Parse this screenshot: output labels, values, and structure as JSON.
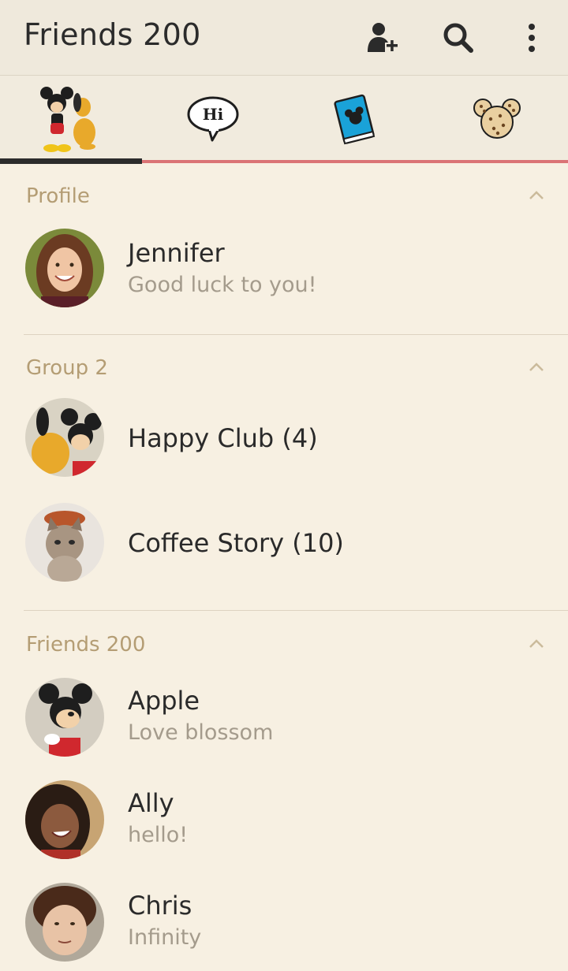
{
  "header": {
    "title": "Friends 200",
    "icons": [
      "add-friend-icon",
      "search-icon",
      "more-icon"
    ]
  },
  "tabs": [
    {
      "name": "friends",
      "icon": "mickey-pluto-icon"
    },
    {
      "name": "chats",
      "icon": "hi-speech-bubble-icon"
    },
    {
      "name": "timeline",
      "icon": "blue-book-icon"
    },
    {
      "name": "more",
      "icon": "cookie-icon"
    }
  ],
  "sections": {
    "profile": {
      "title": "Profile",
      "rows": [
        {
          "name": "Jennifer",
          "status": "Good luck to you!"
        }
      ]
    },
    "groups": {
      "title": "Group 2",
      "rows": [
        {
          "name": "Happy Club (4)"
        },
        {
          "name": "Coffee Story (10)"
        }
      ]
    },
    "friends": {
      "title": "Friends 200",
      "rows": [
        {
          "name": "Apple",
          "status": "Love blossom"
        },
        {
          "name": "Ally",
          "status": "hello!"
        },
        {
          "name": "Chris",
          "status": "Infinity"
        }
      ]
    }
  },
  "colors": {
    "background": "#f7f0e2",
    "section_title": "#b49d74",
    "status_text": "#a49b8c",
    "active_tab_indicator": "#2c2c2c",
    "accent_line": "#d5555a"
  }
}
